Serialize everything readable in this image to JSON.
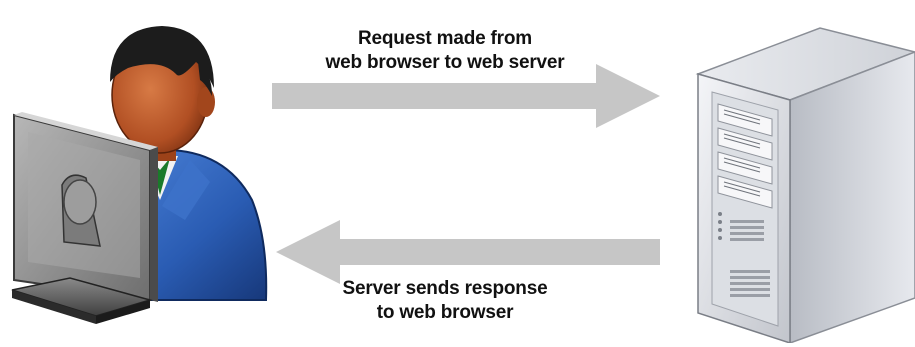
{
  "request_label": {
    "line1": "Request made from",
    "line2": "web browser to web server"
  },
  "response_label": {
    "line1": "Server sends response",
    "line2": "to web browser"
  },
  "icons": {
    "client": "user-at-computer-icon",
    "server": "server-tower-icon",
    "request_arrow": "arrow-right-icon",
    "response_arrow": "arrow-left-icon"
  },
  "colors": {
    "background": "#ffffff",
    "arrow": "#c4c4c4",
    "text": "#111111",
    "skin": "#b5532a",
    "hair": "#1e1e1e",
    "suit": "#2b5fb5",
    "monitor": "#8f8f8f",
    "server_body": "#d6d8de"
  }
}
